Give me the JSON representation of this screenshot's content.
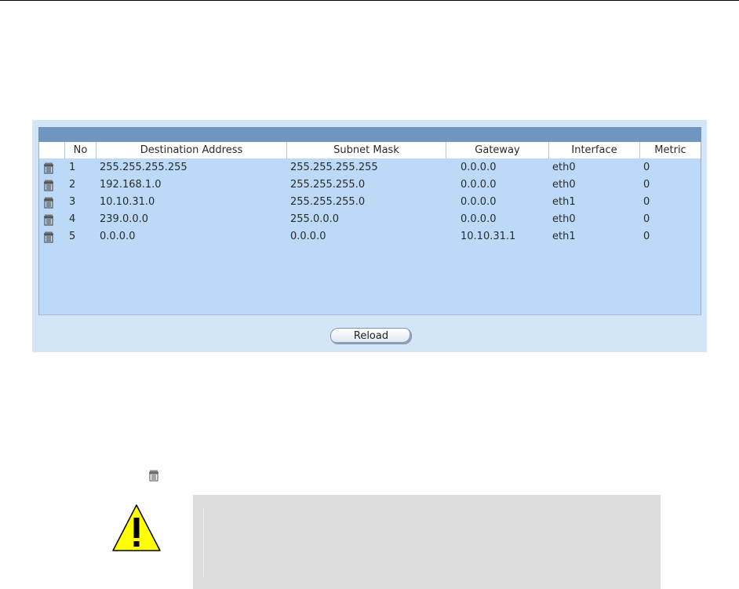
{
  "routes_table": {
    "columns": [
      "No",
      "Destination Address",
      "Subnet Mask",
      "Gateway",
      "Interface",
      "Metric"
    ],
    "rows": [
      {
        "no": "1",
        "destination": "255.255.255.255",
        "mask": "255.255.255.255",
        "gateway": "0.0.0.0",
        "interface": "eth0",
        "metric": "0"
      },
      {
        "no": "2",
        "destination": "192.168.1.0",
        "mask": "255.255.255.0",
        "gateway": "0.0.0.0",
        "interface": "eth0",
        "metric": "0"
      },
      {
        "no": "3",
        "destination": "10.10.31.0",
        "mask": "255.255.255.0",
        "gateway": "0.0.0.0",
        "interface": "eth1",
        "metric": "0"
      },
      {
        "no": "4",
        "destination": "239.0.0.0",
        "mask": "255.0.0.0",
        "gateway": "0.0.0.0",
        "interface": "eth0",
        "metric": "0"
      },
      {
        "no": "5",
        "destination": "0.0.0.0",
        "mask": "0.0.0.0",
        "gateway": "10.10.31.1",
        "interface": "eth1",
        "metric": "0"
      }
    ],
    "row_icon": "trash-icon"
  },
  "actions": {
    "reload_label": "Reload"
  },
  "legend": {
    "icon": "trash-icon"
  },
  "note": {
    "icon": "warning-icon"
  },
  "colors": {
    "panel_bg": "#d3e6f9",
    "header_bar": "#7095c1",
    "table_bg": "#bcdaf7",
    "note_bg": "#dcdcdc",
    "warning_yellow": "#ffff00"
  }
}
